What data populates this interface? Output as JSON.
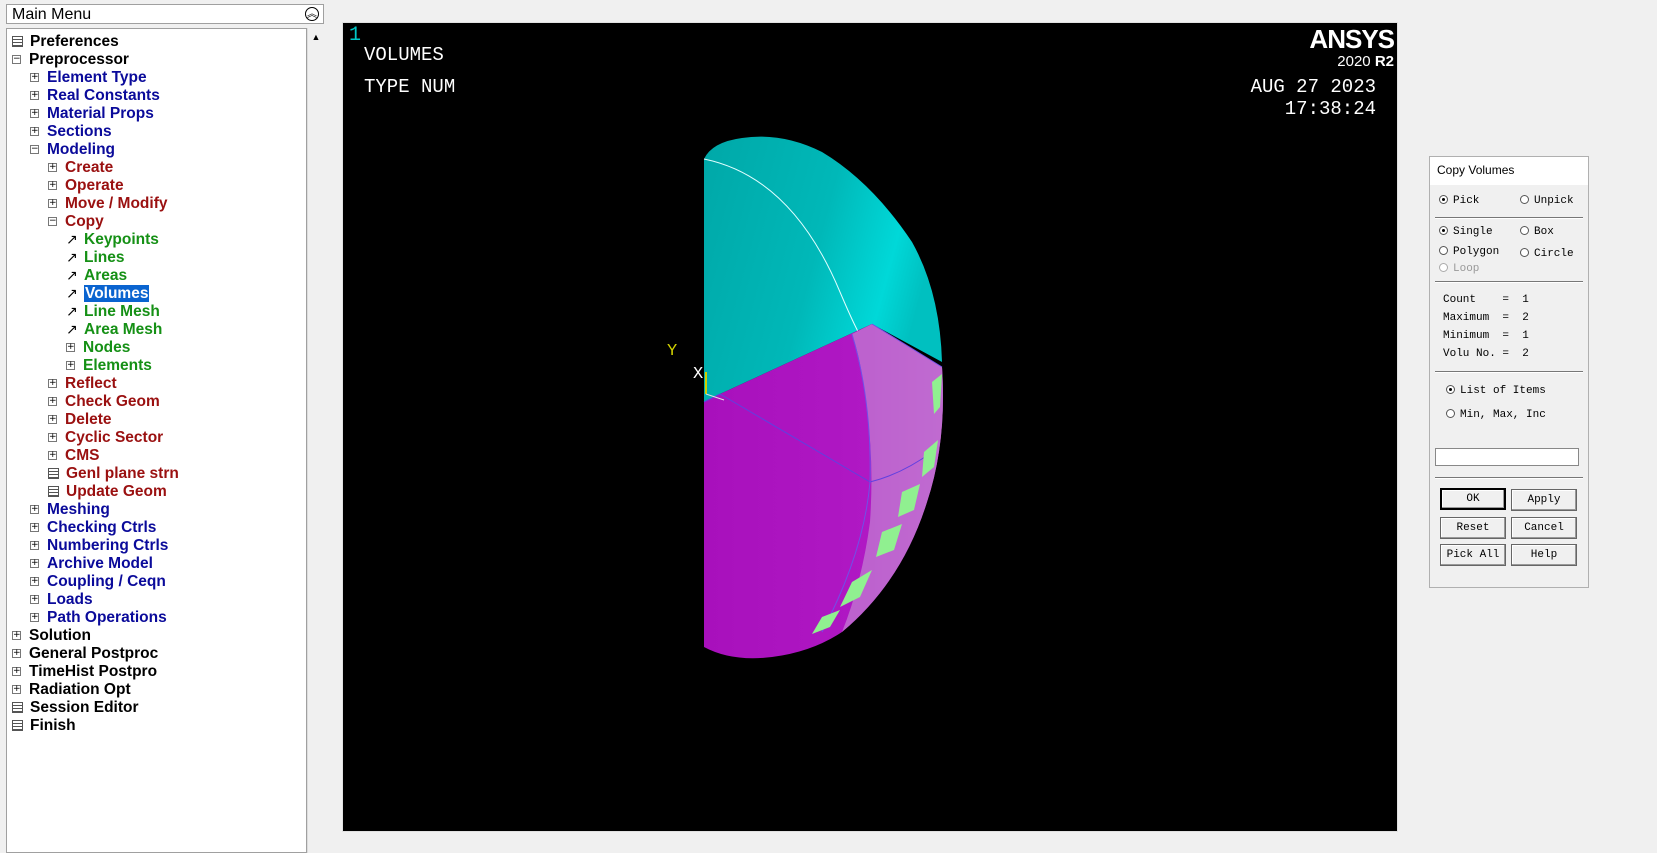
{
  "main_menu": {
    "title": "Main Menu",
    "items": [
      {
        "label": "Preferences",
        "marker": "calc",
        "color": "black",
        "indent": 0
      },
      {
        "label": "Preprocessor",
        "marker": "minus",
        "color": "black",
        "indent": 0
      },
      {
        "label": "Element Type",
        "marker": "plus",
        "color": "blue",
        "indent": 1
      },
      {
        "label": "Real Constants",
        "marker": "plus",
        "color": "blue",
        "indent": 1
      },
      {
        "label": "Material Props",
        "marker": "plus",
        "color": "blue",
        "indent": 1
      },
      {
        "label": "Sections",
        "marker": "plus",
        "color": "blue",
        "indent": 1
      },
      {
        "label": "Modeling",
        "marker": "minus",
        "color": "blue",
        "indent": 1
      },
      {
        "label": "Create",
        "marker": "plus",
        "color": "red",
        "indent": 2
      },
      {
        "label": "Operate",
        "marker": "plus",
        "color": "red",
        "indent": 2
      },
      {
        "label": "Move / Modify",
        "marker": "plus",
        "color": "red",
        "indent": 2
      },
      {
        "label": "Copy",
        "marker": "minus",
        "color": "red",
        "indent": 2
      },
      {
        "label": "Keypoints",
        "marker": "arrow",
        "color": "green",
        "indent": 3
      },
      {
        "label": "Lines",
        "marker": "arrow",
        "color": "green",
        "indent": 3
      },
      {
        "label": "Areas",
        "marker": "arrow",
        "color": "green",
        "indent": 3
      },
      {
        "label": "Volumes",
        "marker": "arrow",
        "color": "green",
        "indent": 3,
        "selected": true
      },
      {
        "label": "Line Mesh",
        "marker": "arrow",
        "color": "green",
        "indent": 3
      },
      {
        "label": "Area Mesh",
        "marker": "arrow",
        "color": "green",
        "indent": 3
      },
      {
        "label": "Nodes",
        "marker": "plus",
        "color": "green",
        "indent": 3
      },
      {
        "label": "Elements",
        "marker": "plus",
        "color": "green",
        "indent": 3
      },
      {
        "label": "Reflect",
        "marker": "plus",
        "color": "red",
        "indent": 2
      },
      {
        "label": "Check Geom",
        "marker": "plus",
        "color": "red",
        "indent": 2
      },
      {
        "label": "Delete",
        "marker": "plus",
        "color": "red",
        "indent": 2
      },
      {
        "label": "Cyclic Sector",
        "marker": "plus",
        "color": "red",
        "indent": 2
      },
      {
        "label": "CMS",
        "marker": "plus",
        "color": "red",
        "indent": 2
      },
      {
        "label": "Genl plane strn",
        "marker": "calc",
        "color": "red",
        "indent": 2
      },
      {
        "label": "Update Geom",
        "marker": "calc",
        "color": "red",
        "indent": 2
      },
      {
        "label": "Meshing",
        "marker": "plus",
        "color": "blue",
        "indent": 1
      },
      {
        "label": "Checking Ctrls",
        "marker": "plus",
        "color": "blue",
        "indent": 1
      },
      {
        "label": "Numbering Ctrls",
        "marker": "plus",
        "color": "blue",
        "indent": 1
      },
      {
        "label": "Archive Model",
        "marker": "plus",
        "color": "blue",
        "indent": 1
      },
      {
        "label": "Coupling / Ceqn",
        "marker": "plus",
        "color": "blue",
        "indent": 1
      },
      {
        "label": "Loads",
        "marker": "plus",
        "color": "blue",
        "indent": 1
      },
      {
        "label": "Path Operations",
        "marker": "plus",
        "color": "blue",
        "indent": 1
      },
      {
        "label": "Solution",
        "marker": "plus",
        "color": "black",
        "indent": 0
      },
      {
        "label": "General Postproc",
        "marker": "plus",
        "color": "black",
        "indent": 0
      },
      {
        "label": "TimeHist Postpro",
        "marker": "plus",
        "color": "black",
        "indent": 0
      },
      {
        "label": "Radiation Opt",
        "marker": "plus",
        "color": "black",
        "indent": 0
      },
      {
        "label": "Session Editor",
        "marker": "calc",
        "color": "black",
        "indent": 0
      },
      {
        "label": "Finish",
        "marker": "calc",
        "color": "black",
        "indent": 0
      }
    ]
  },
  "graphics": {
    "window_number": "1",
    "plot_title": "VOLUMES",
    "plot_subtitle": "TYPE NUM",
    "date": "AUG 27 2023",
    "time": "17:38:24",
    "logo": "ANSYS",
    "version": "2020",
    "release": "R2",
    "axis_y": "Y",
    "axis_x": "X",
    "colors": {
      "cyan_volume": "#00b4b4",
      "magenta_volume": "#b014c0",
      "mesh_highlight": "#90f090"
    }
  },
  "dialog": {
    "title": "Copy Volumes",
    "pick": "Pick",
    "unpick": "Unpick",
    "single": "Single",
    "box": "Box",
    "polygon": "Polygon",
    "circle": "Circle",
    "loop": "Loop",
    "count": "Count    =  1",
    "maximum": "Maximum  =  2",
    "minimum": "Minimum  =  1",
    "volu_no": "Volu No. =  2",
    "list_of_items": "List of Items",
    "min_max_inc": "Min, Max, Inc",
    "input_value": "",
    "ok": "OK",
    "apply": "Apply",
    "reset": "Reset",
    "cancel": "Cancel",
    "pick_all": "Pick All",
    "help": "Help"
  }
}
